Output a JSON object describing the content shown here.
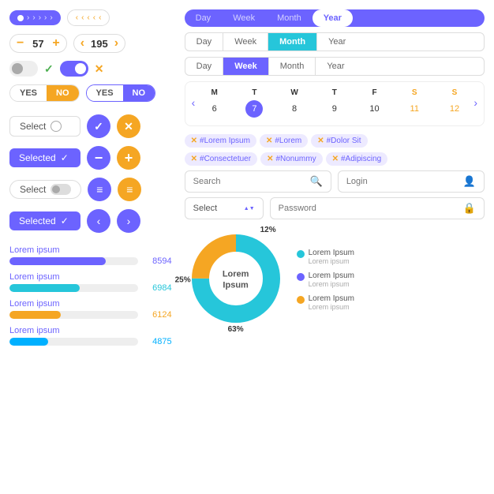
{
  "left": {
    "pagination1": {
      "dots": 1,
      "arrows": [
        "»",
        "»",
        "»",
        "»",
        "»"
      ]
    },
    "pagination2": {
      "arrows": [
        "«",
        "«",
        "«",
        "«",
        "«"
      ]
    },
    "stepper1": {
      "minus": "−",
      "value": "57",
      "plus": "+"
    },
    "stepper2": {
      "left": "‹",
      "value": "195",
      "right": "›"
    },
    "yesno1": {
      "yes": "YES",
      "no": "NO"
    },
    "yesno2": {
      "yes": "YES",
      "no": "NO"
    },
    "select1": {
      "label": "Select"
    },
    "selected1": {
      "label": "Selected"
    },
    "select2": {
      "label": "Select"
    },
    "selected2": {
      "label": "Selected"
    },
    "progress": [
      {
        "label": "Lorem ipsum",
        "value": 75,
        "color": "purple",
        "num": "8594"
      },
      {
        "label": "Lorem ipsum",
        "value": 55,
        "color": "blue",
        "num": "6984"
      },
      {
        "label": "Lorem ipsum",
        "value": 40,
        "color": "orange",
        "num": "6124"
      },
      {
        "label": "Lorem ipsum",
        "value": 35,
        "color": "cyan",
        "num": "4875"
      }
    ]
  },
  "right": {
    "tabs1": [
      {
        "label": "Day",
        "active": false
      },
      {
        "label": "Week",
        "active": false
      },
      {
        "label": "Month",
        "active": false
      },
      {
        "label": "Year",
        "active": true
      }
    ],
    "tabs2": [
      {
        "label": "Day",
        "active": false
      },
      {
        "label": "Week",
        "active": false
      },
      {
        "label": "Month",
        "active": true
      },
      {
        "label": "Year",
        "active": false
      }
    ],
    "tabs3": [
      {
        "label": "Day",
        "active": false
      },
      {
        "label": "Week",
        "active": true
      },
      {
        "label": "Month",
        "active": false
      },
      {
        "label": "Year",
        "active": false
      }
    ],
    "calendar": {
      "days": [
        "M",
        "T",
        "W",
        "T",
        "F",
        "S",
        "S"
      ],
      "nums": [
        "6",
        "7",
        "8",
        "9",
        "10",
        "11",
        "12"
      ],
      "today": "7",
      "weekends": [
        "11",
        "12"
      ]
    },
    "tags": [
      "#Lorem Ipsum",
      "#Lorem",
      "#Dolor Sit",
      "#Consectetuer",
      "#Nonummy",
      "#Adipiscing"
    ],
    "search_placeholder": "Search",
    "login_placeholder": "Login",
    "select_placeholder": "Select",
    "password_placeholder": "Password",
    "donut": {
      "label1": "Lorem",
      "label2": "Ipsum",
      "segments": [
        {
          "label": "63%",
          "color": "#26c6da",
          "pct": 63
        },
        {
          "label": "25%",
          "color": "#f5a623",
          "pct": 25
        },
        {
          "label": "12%",
          "color": "#6c63ff",
          "pct": 12
        }
      ],
      "legend": [
        {
          "color": "#26c6da",
          "text": "Lorem Ipsum",
          "sub": "Lorem ipsum"
        },
        {
          "color": "#6c63ff",
          "text": "Lorem Ipsum",
          "sub": "Lorem ipsum"
        },
        {
          "color": "#f5a623",
          "text": "Lorem Ipsum",
          "sub": "Lorem ipsum"
        }
      ]
    }
  }
}
